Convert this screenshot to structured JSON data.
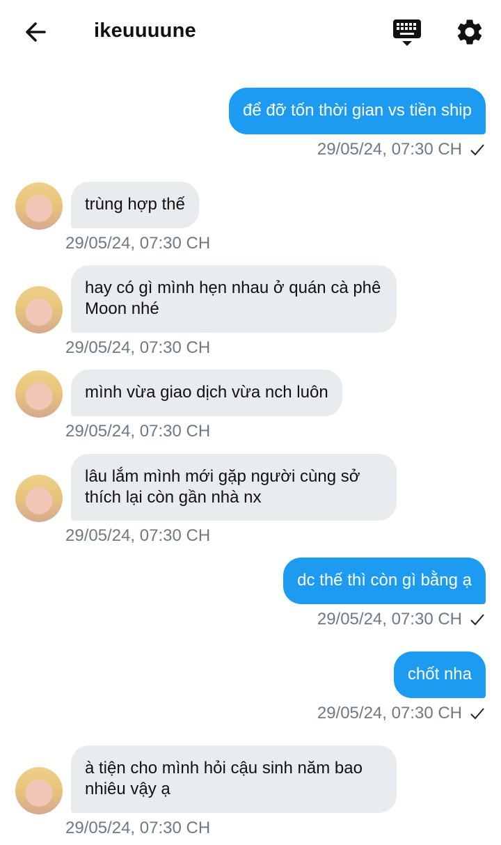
{
  "header": {
    "title": "ikeuuuune"
  },
  "messages": [
    {
      "dir": "out",
      "text": "để đỡ tốn thời gian vs tiền ship",
      "time": "29/05/24, 07:30 CH"
    },
    {
      "dir": "in",
      "text": "trùng hợp thế",
      "time": "29/05/24, 07:30 CH"
    },
    {
      "dir": "in",
      "text": "hay có gì mình hẹn nhau ở quán cà phê Moon nhé",
      "time": "29/05/24, 07:30 CH"
    },
    {
      "dir": "in",
      "text": "mình vừa giao dịch vừa nch luôn",
      "time": "29/05/24, 07:30 CH"
    },
    {
      "dir": "in",
      "text": "lâu lắm mình mới gặp người cùng sở thích lại còn gần nhà nx",
      "time": "29/05/24, 07:30 CH"
    },
    {
      "dir": "out",
      "text": "dc thế thì còn gì bằng ạ",
      "time": "29/05/24, 07:30 CH"
    },
    {
      "dir": "out",
      "text": "chốt nha",
      "time": "29/05/24, 07:30 CH"
    },
    {
      "dir": "in",
      "text": "à tiện cho mình hỏi cậu sinh năm bao nhiêu vậy ạ",
      "time": "29/05/24, 07:30 CH"
    }
  ],
  "colors": {
    "outgoing": "#1d9bf0",
    "incoming": "#e8ecef",
    "timestamp": "#6c7a86"
  },
  "icons": {
    "back": "arrow-left",
    "keyboard": "keyboard",
    "settings": "gear",
    "sent": "checkmark"
  }
}
